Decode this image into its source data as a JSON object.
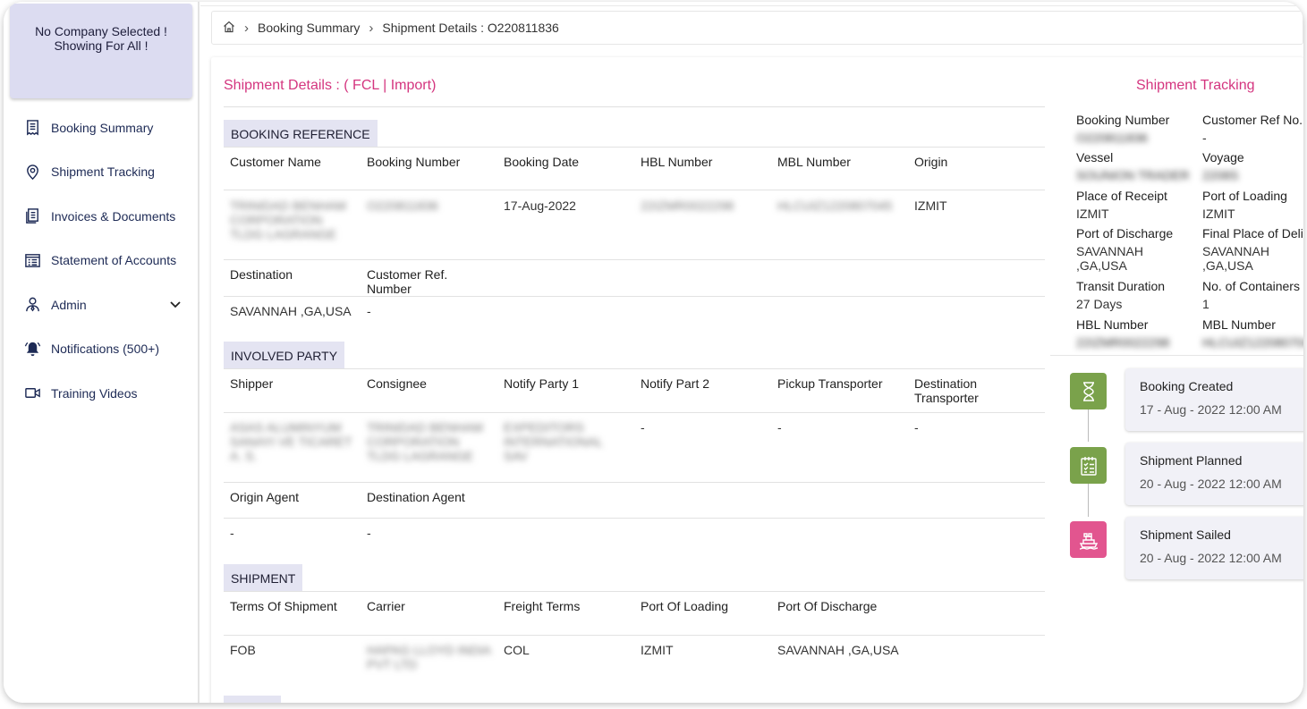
{
  "sidebar": {
    "company_notice_line1": "No Company Selected !",
    "company_notice_line2": "Showing For All !",
    "items": [
      {
        "label": "Booking Summary"
      },
      {
        "label": "Shipment Tracking"
      },
      {
        "label": "Invoices & Documents"
      },
      {
        "label": "Statement of Accounts"
      },
      {
        "label": "Admin"
      },
      {
        "label": "Notifications (500+)"
      },
      {
        "label": "Training Videos"
      }
    ]
  },
  "breadcrumb": {
    "crumb1": "Booking Summary",
    "crumb2": "Shipment Details : O220811836"
  },
  "details": {
    "title": "Shipment Details : ( FCL | Import)",
    "booking_reference": {
      "heading": "BOOKING REFERENCE",
      "headers": [
        "Customer Name",
        "Booking Number",
        "Booking Date",
        "HBL Number",
        "MBL Number",
        "Origin"
      ],
      "values": [
        "TRINIDAD BENHAM CORPORATION TLDG LAGRANGE",
        "O220811836",
        "17-Aug-2022",
        "22IZMR0022298",
        "HLCUIZ1220807045",
        "IZMIT"
      ],
      "headers2": [
        "Destination",
        "Customer Ref. Number"
      ],
      "values2": [
        "SAVANNAH ,GA,USA",
        "-"
      ]
    },
    "involved_party": {
      "heading": "INVOLVED PARTY",
      "headers": [
        "Shipper",
        "Consignee",
        "Notify Party 1",
        "Notify Part 2",
        "Pickup Transporter",
        "Destination Transporter"
      ],
      "values": [
        "ASAS ALUMINYUM SANAYI VE TICARET A. S.",
        "TRINIDAD BENHAM CORPORATION TLDG LAGRANGE",
        "EXPEDITORS INTERNATIONAL SAV",
        "-",
        "-",
        "-"
      ],
      "headers2": [
        "Origin Agent",
        "Destination Agent"
      ],
      "values2": [
        "-",
        "-"
      ]
    },
    "shipment": {
      "heading": "SHIPMENT",
      "headers": [
        "Terms Of Shipment",
        "Carrier",
        "Freight Terms",
        "Port Of Loading",
        "Port Of Discharge"
      ],
      "values": [
        "FOB",
        "HAPAG LLOYD INDIA PVT LTD",
        "COL",
        "IZMIT",
        "SAVANNAH ,GA,USA"
      ]
    }
  },
  "tracking": {
    "title": "Shipment Tracking",
    "fields": [
      {
        "label": "Booking Number",
        "value": "O220811836",
        "blurred": true
      },
      {
        "label": "Customer Ref No.",
        "value": "-",
        "blurred": false
      },
      {
        "label": "Vessel",
        "value": "SOUNION TRADER",
        "blurred": true
      },
      {
        "label": "Voyage",
        "value": "2208S",
        "blurred": true
      },
      {
        "label": "Place of Receipt",
        "value": "IZMIT",
        "blurred": false
      },
      {
        "label": "Port of Loading",
        "value": "IZMIT",
        "blurred": false
      },
      {
        "label": "Port of Discharge",
        "value": "SAVANNAH ,GA,USA",
        "blurred": false
      },
      {
        "label": "Final Place of Deli",
        "value": "SAVANNAH ,GA,USA",
        "blurred": false
      },
      {
        "label": "Transit Duration",
        "value": "27 Days",
        "blurred": false
      },
      {
        "label": "No. of Containers",
        "value": "1",
        "blurred": false
      },
      {
        "label": "HBL Number",
        "value": "22IZMR0022298",
        "blurred": true
      },
      {
        "label": "MBL Number",
        "value": "HLCUIZ1220807045",
        "blurred": true
      }
    ],
    "events": [
      {
        "title": "Booking Created",
        "date": "17 - Aug - 2022 12:00 AM",
        "color": "#7aa24b"
      },
      {
        "title": "Shipment Planned",
        "date": "20 - Aug - 2022 12:00 AM",
        "color": "#7aa24b"
      },
      {
        "title": "Shipment Sailed",
        "date": "20 - Aug - 2022 12:00 AM",
        "color": "#e2558f"
      }
    ]
  },
  "colors": {
    "accent": "#d4357f",
    "section_bg": "#e4e4f2",
    "company_bg": "#dcdcf1",
    "nav_text": "#1d2a55"
  }
}
